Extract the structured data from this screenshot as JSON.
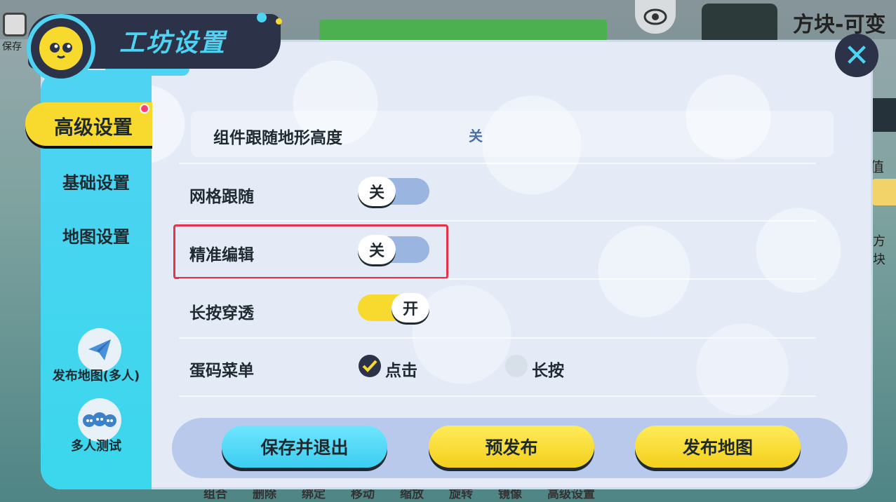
{
  "topbar": {
    "save_label": "保存",
    "map_title": "方块-可变",
    "right_label_1": "值",
    "right_label_2": "方块"
  },
  "header": {
    "title": "工坊设置",
    "close_symbol": "✕"
  },
  "sidebar": {
    "active_label": "高级设置",
    "items": [
      {
        "label": "基础设置"
      },
      {
        "label": "地图设置"
      }
    ],
    "publish_multi_label": "发布地图(多人)",
    "multi_test_label": "多人测试"
  },
  "settings": {
    "terrain_follow": {
      "label": "组件跟随地形高度",
      "value": "关"
    },
    "grid_follow": {
      "label": "网格跟随",
      "toggle_text": "关",
      "state": "off"
    },
    "precise_edit": {
      "label": "精准编辑",
      "toggle_text": "关",
      "state": "off"
    },
    "long_press_through": {
      "label": "长按穿透",
      "toggle_text": "开",
      "state": "on"
    },
    "egg_menu": {
      "label": "蛋码菜单",
      "options": [
        {
          "label": "点击",
          "selected": true
        },
        {
          "label": "长按",
          "selected": false
        }
      ]
    }
  },
  "buttons": {
    "save_exit": "保存并退出",
    "pre_publish": "预发布",
    "publish_map": "发布地图"
  },
  "bottom_tools": [
    "组合",
    "删除",
    "绑定",
    "移动",
    "缩放",
    "旋转",
    "镜像",
    "高级设置"
  ],
  "colors": {
    "accent_cyan": "#4fd3f3",
    "accent_yellow": "#f8d92e",
    "dark": "#2c3348",
    "highlight_red": "#e3344a"
  }
}
